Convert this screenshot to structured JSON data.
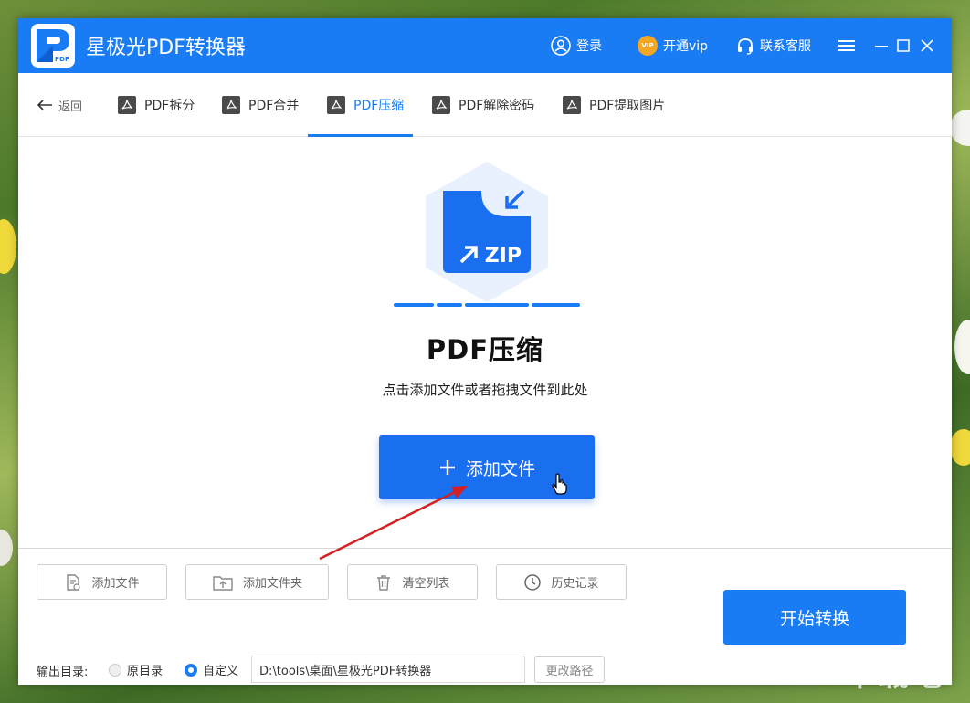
{
  "app": {
    "title": "星极光PDF转换器",
    "logo_text": "PDF",
    "brand_color": "#1a7cf4"
  },
  "titlebar": {
    "login_label": "登录",
    "login_icon": "user-circle-icon",
    "vip_badge": "VIP",
    "vip_label": "开通vip",
    "support_label": "联系客服",
    "support_icon": "headset-icon",
    "menu_icon": "hamburger-menu-icon",
    "minimize_icon": "minimize-icon",
    "maximize_icon": "maximize-icon",
    "close_icon": "close-icon"
  },
  "nav": {
    "back_label": "返回",
    "tabs": [
      {
        "label": "PDF拆分",
        "icon": "pdf-icon",
        "active": false
      },
      {
        "label": "PDF合并",
        "icon": "pdf-icon",
        "active": false
      },
      {
        "label": "PDF压缩",
        "icon": "pdf-icon",
        "active": true
      },
      {
        "label": "PDF解除密码",
        "icon": "pdf-icon",
        "active": false
      },
      {
        "label": "PDF提取图片",
        "icon": "pdf-icon",
        "active": false
      }
    ]
  },
  "main": {
    "hero_icon": "zip-compress-icon",
    "hero_badge": "ZIP",
    "title": "PDF压缩",
    "subtitle": "点击添加文件或者拖拽文件到此处",
    "add_button_label": "添加文件"
  },
  "toolbar": {
    "add_file": "添加文件",
    "add_folder": "添加文件夹",
    "clear_list": "清空列表",
    "history": "历史记录",
    "start": "开始转换"
  },
  "output": {
    "label": "输出目录:",
    "option_original": "原目录",
    "option_custom": "自定义",
    "selected": "自定义",
    "path": "D:\\tools\\桌面\\星极光PDF转换器",
    "change_path": "更改路径"
  },
  "watermark": "下载吧"
}
